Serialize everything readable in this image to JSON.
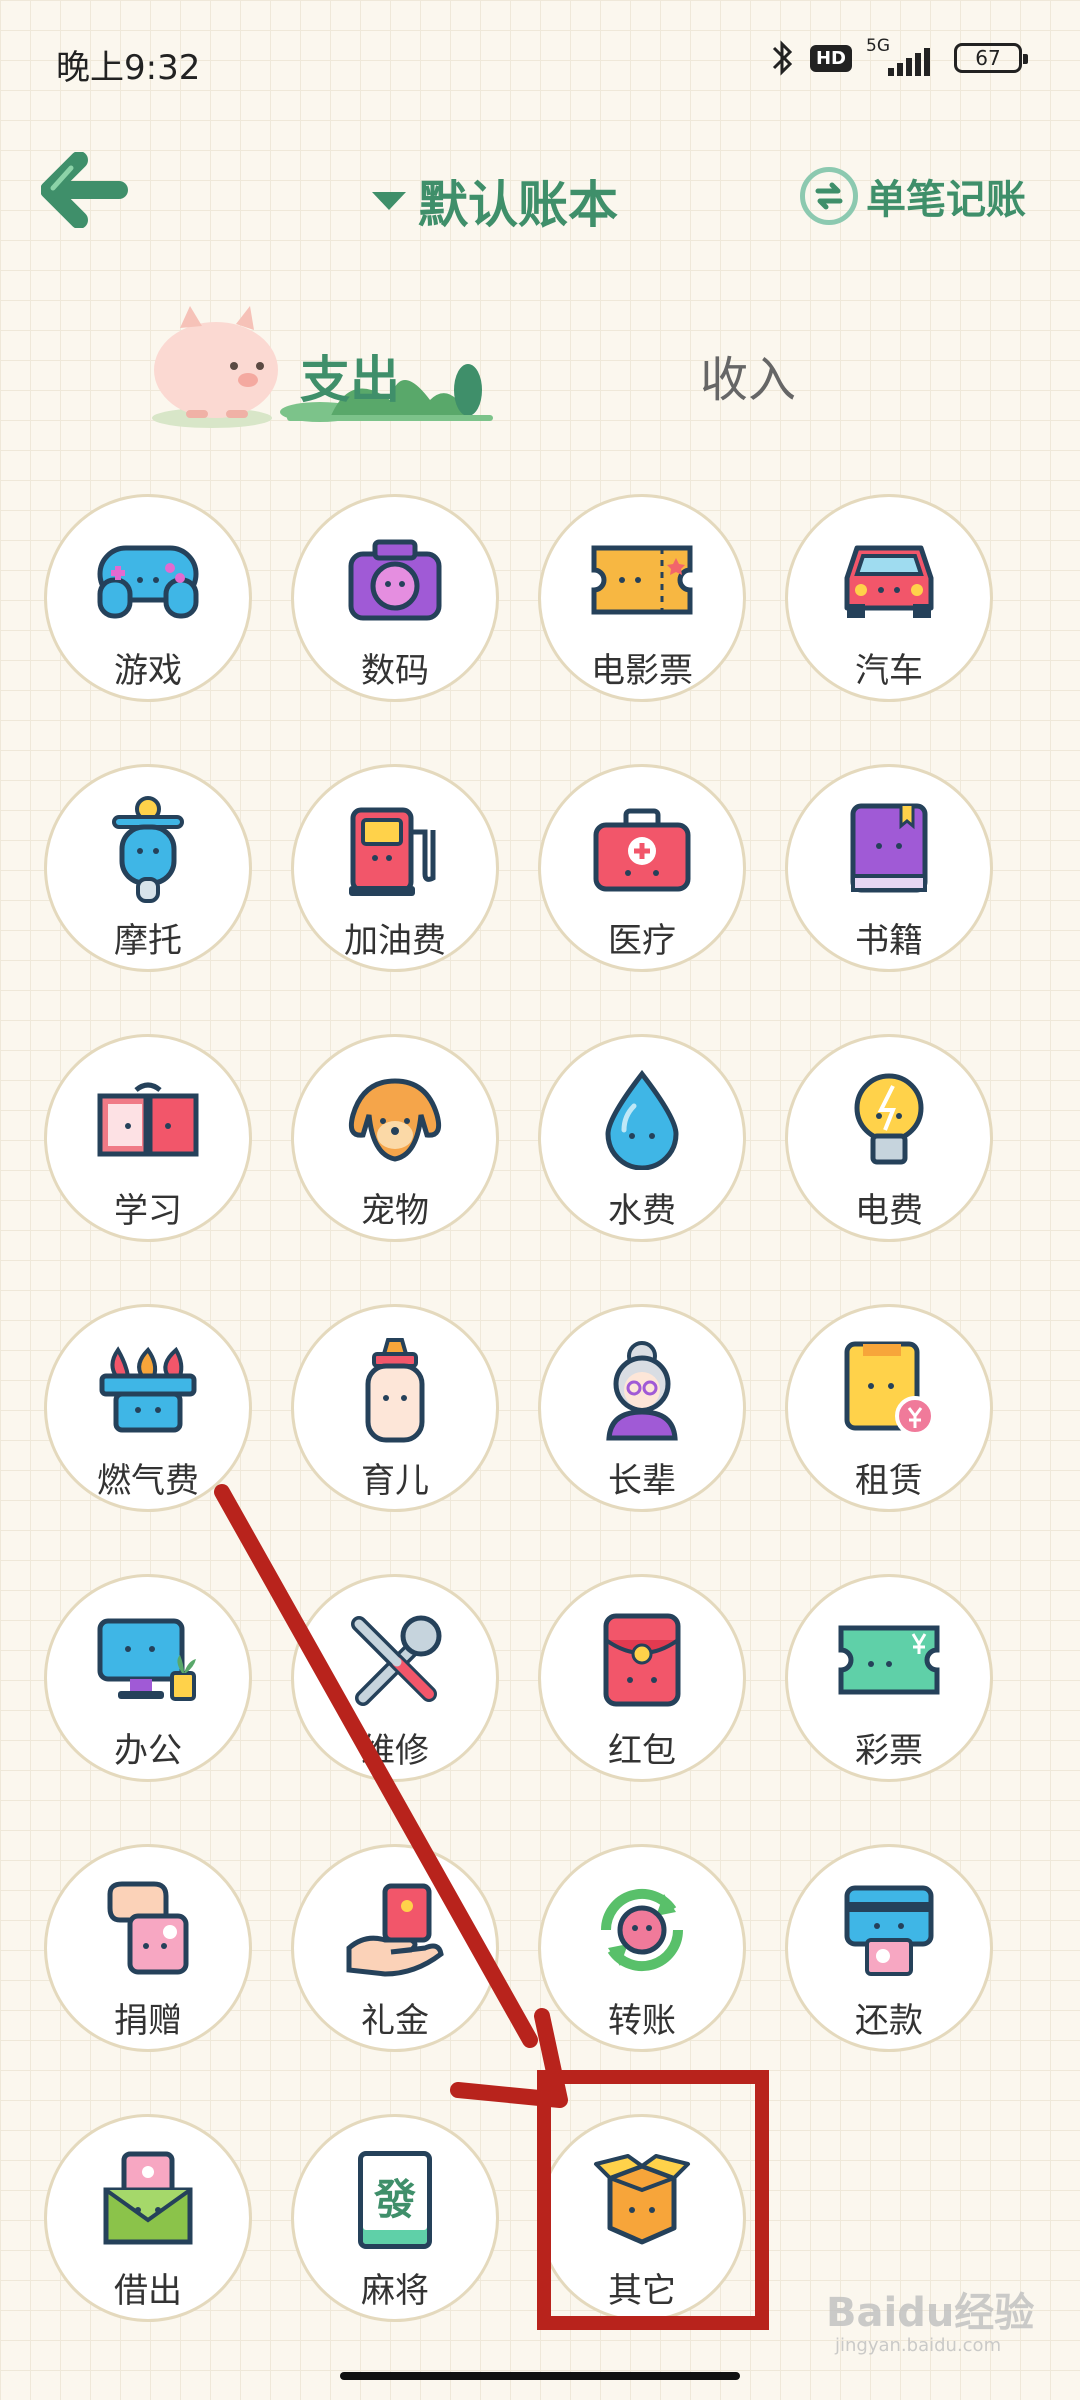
{
  "status_bar": {
    "time": "晚上9:32",
    "hd_label": "HD",
    "network_label": "5G",
    "battery": "67"
  },
  "header": {
    "back_icon": "arrow-left-icon",
    "book_title": "默认账本",
    "single_entry_label": "单笔记账"
  },
  "tabs": {
    "expense": "支出",
    "income": "收入",
    "active": "expense"
  },
  "categories": [
    {
      "label": "游戏",
      "icon": "gamepad-icon"
    },
    {
      "label": "数码",
      "icon": "camera-icon"
    },
    {
      "label": "电影票",
      "icon": "ticket-icon"
    },
    {
      "label": "汽车",
      "icon": "car-icon"
    },
    {
      "label": "摩托",
      "icon": "scooter-icon"
    },
    {
      "label": "加油费",
      "icon": "fuel-pump-icon"
    },
    {
      "label": "医疗",
      "icon": "medical-kit-icon"
    },
    {
      "label": "书籍",
      "icon": "book-icon"
    },
    {
      "label": "学习",
      "icon": "open-book-icon"
    },
    {
      "label": "宠物",
      "icon": "dog-icon"
    },
    {
      "label": "水费",
      "icon": "water-drop-icon"
    },
    {
      "label": "电费",
      "icon": "light-bulb-icon"
    },
    {
      "label": "燃气费",
      "icon": "gas-stove-icon"
    },
    {
      "label": "育儿",
      "icon": "baby-bottle-icon"
    },
    {
      "label": "长辈",
      "icon": "grandma-icon"
    },
    {
      "label": "租赁",
      "icon": "rent-icon"
    },
    {
      "label": "办公",
      "icon": "monitor-icon"
    },
    {
      "label": "维修",
      "icon": "tools-icon"
    },
    {
      "label": "红包",
      "icon": "red-envelope-icon"
    },
    {
      "label": "彩票",
      "icon": "lottery-ticket-icon"
    },
    {
      "label": "捐赠",
      "icon": "donation-icon"
    },
    {
      "label": "礼金",
      "icon": "gift-money-icon"
    },
    {
      "label": "转账",
      "icon": "transfer-icon"
    },
    {
      "label": "还款",
      "icon": "repayment-icon"
    },
    {
      "label": "借出",
      "icon": "lend-icon"
    },
    {
      "label": "麻将",
      "icon": "mahjong-icon"
    },
    {
      "label": "其它",
      "icon": "box-icon"
    }
  ],
  "mahjong_tile_char": "發",
  "watermark": {
    "main": "Baidu经验",
    "sub": "jingyan.baidu.com"
  },
  "colors": {
    "accent": "#3f8f6a",
    "background": "#fbf7ee",
    "annotation": "#b8231c"
  }
}
